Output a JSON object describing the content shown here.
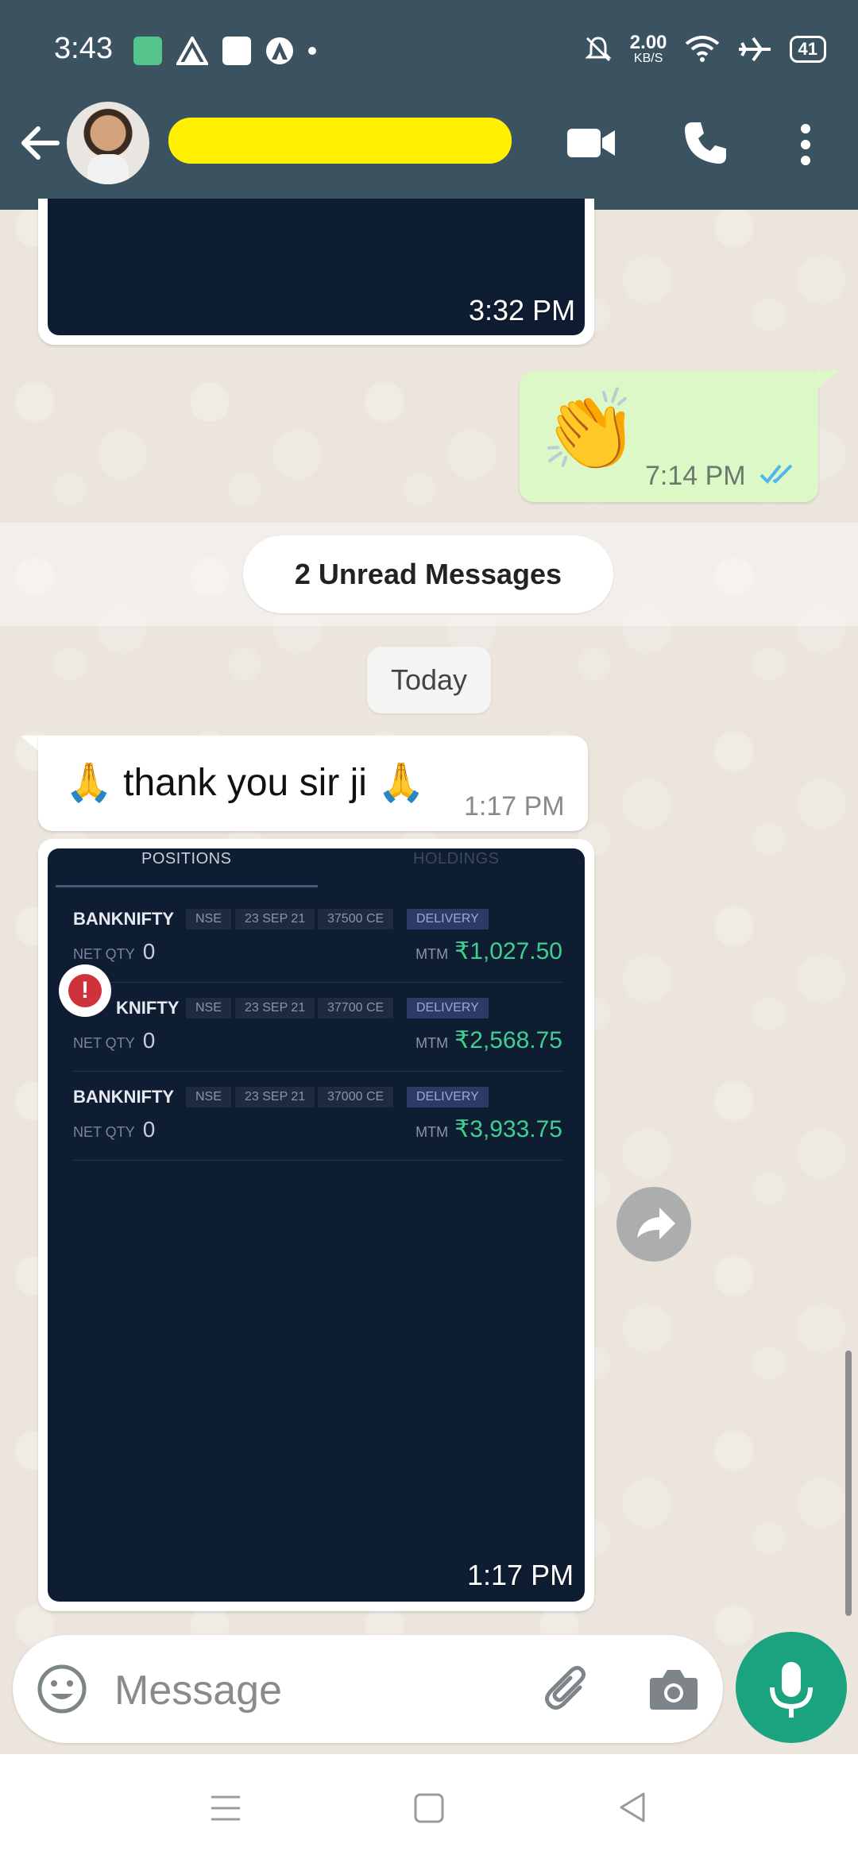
{
  "status_bar": {
    "time": "3:43",
    "network_speed": "2.00",
    "network_unit": "KB/S",
    "battery": "41"
  },
  "header": {
    "contact_name_redacted": true
  },
  "messages": {
    "prev_image_time": "3:32 PM",
    "clap_time": "7:14 PM",
    "clap_emoji": "👏",
    "unread_label": "2 Unread Messages",
    "date_label": "Today",
    "thank_text": "🙏 thank you sir ji 🙏",
    "thank_time": "1:17 PM",
    "image_time": "1:17 PM"
  },
  "positions": {
    "tabs": [
      "POSITIONS",
      "HOLDINGS"
    ],
    "rows": [
      {
        "symbol": "BANKNIFTY",
        "exchange": "NSE",
        "expiry": "23 SEP 21",
        "strike": "37500 CE",
        "type": "DELIVERY",
        "net_qty_label": "NET QTY",
        "net_qty": "0",
        "mtm_label": "MTM",
        "mtm": "₹1,027.50"
      },
      {
        "symbol": "KNIFTY",
        "exchange": "NSE",
        "expiry": "23 SEP 21",
        "strike": "37700 CE",
        "type": "DELIVERY",
        "net_qty_label": "NET QTY",
        "net_qty": "0",
        "mtm_label": "MTM",
        "mtm": "₹2,568.75"
      },
      {
        "symbol": "BANKNIFTY",
        "exchange": "NSE",
        "expiry": "23 SEP 21",
        "strike": "37000 CE",
        "type": "DELIVERY",
        "net_qty_label": "NET QTY",
        "net_qty": "0",
        "mtm_label": "MTM",
        "mtm": "₹3,933.75"
      }
    ]
  },
  "composer": {
    "placeholder": "Message"
  },
  "colors": {
    "header": "#3b5361",
    "accent_green": "#1ba37f",
    "outgoing_bubble": "#dcf8c6",
    "read_ticks": "#4fb6ec",
    "mtm_green": "#3fcf8e"
  }
}
